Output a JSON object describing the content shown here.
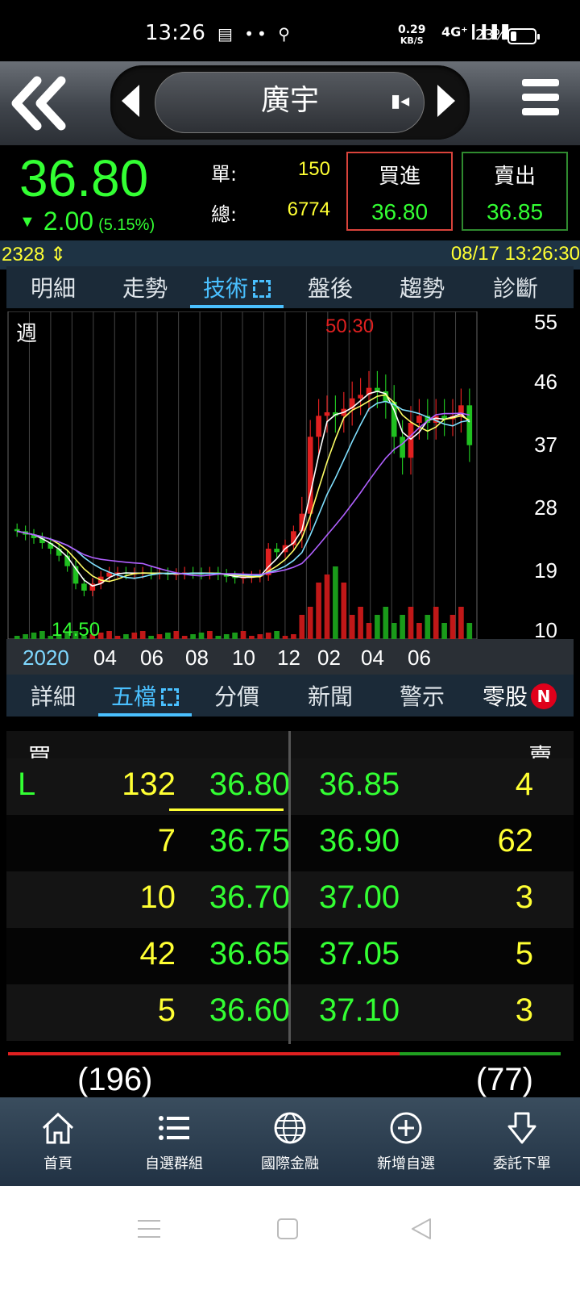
{
  "status_bar": {
    "time": "13:26",
    "net_speed_value": "0.29",
    "net_speed_unit": "KB/S",
    "signal": "4G⁺",
    "battery": "23%"
  },
  "header": {
    "stock_name": "廣宇"
  },
  "quote": {
    "price": "36.80",
    "change": "2.00",
    "change_pct": "(5.15%)",
    "single_label": "單:",
    "single_value": "150",
    "total_label": "總:",
    "total_value": "6774",
    "buy_label": "買進",
    "buy_price": "36.80",
    "sell_label": "賣出",
    "sell_price": "36.85",
    "colors": {
      "up_green": "#33ff33",
      "volume_yellow": "#ffff33",
      "buy_border": "#d9433b",
      "sell_border": "#2f8a2f"
    }
  },
  "info_bar": {
    "code": "2328",
    "datetime": "08/17 13:26:30"
  },
  "tabs_top": [
    {
      "label": "明細"
    },
    {
      "label": "走勢"
    },
    {
      "label": "技術",
      "active": true
    },
    {
      "label": "盤後"
    },
    {
      "label": "趨勢"
    },
    {
      "label": "診斷"
    }
  ],
  "chart": {
    "period_label": "週",
    "high_label": "50.30",
    "low_label": "14.50",
    "y_ticks": [
      "55",
      "46",
      "37",
      "28",
      "19",
      "10"
    ],
    "x_ticks": [
      "2020",
      "04",
      "06",
      "08",
      "10",
      "12",
      "02",
      "04",
      "06"
    ]
  },
  "chart_data": {
    "type": "candlestick",
    "ylim": [
      10,
      55
    ],
    "y_ticks": [
      55,
      46,
      37,
      28,
      19,
      10
    ],
    "x_ticks": [
      "2020",
      "04",
      "06",
      "08",
      "10",
      "12",
      "02",
      "04",
      "06"
    ],
    "period": "週",
    "highest": 50.3,
    "lowest": 14.5,
    "weekly_close_approx": [
      24.5,
      24.0,
      23.5,
      22.8,
      22.0,
      21.0,
      19.5,
      17.0,
      16.0,
      17.0,
      18.0,
      18.6,
      18.6,
      18.4,
      18.5,
      18.6,
      18.4,
      18.5,
      18.3,
      18.4,
      18.6,
      18.5,
      18.4,
      18.6,
      18.3,
      18.0,
      17.8,
      17.9,
      18.0,
      18.2,
      22.0,
      21.5,
      22.5,
      24.5,
      27.0,
      38.0,
      41.0,
      41.5,
      41.0,
      42.0,
      43.5,
      44.0,
      45.0,
      44.5,
      43.0,
      38.0,
      35.0,
      40.0,
      41.0,
      40.0,
      41.0,
      40.5,
      41.0,
      42.5,
      36.8
    ],
    "colors": {
      "up": "#e02020",
      "down": "#20c020",
      "ma_white": "#ffffff",
      "ma_yellow": "#ffff66",
      "ma_cyan": "#80e0ff",
      "ma_purple": "#b060ff"
    }
  },
  "tabs_bottom": [
    {
      "label": "詳細"
    },
    {
      "label": "五檔",
      "active": true
    },
    {
      "label": "分價"
    },
    {
      "label": "新聞"
    },
    {
      "label": "警示"
    },
    {
      "label": "零股",
      "badge": "N"
    }
  ],
  "order_book": {
    "buy_header": "買",
    "sell_header": "賣",
    "rows": [
      {
        "flag": "L",
        "bid_qty": "132",
        "bid": "36.80",
        "ask": "36.85",
        "ask_qty": "4"
      },
      {
        "flag": "",
        "bid_qty": "7",
        "bid": "36.75",
        "ask": "36.90",
        "ask_qty": "62"
      },
      {
        "flag": "",
        "bid_qty": "10",
        "bid": "36.70",
        "ask": "37.00",
        "ask_qty": "3"
      },
      {
        "flag": "",
        "bid_qty": "42",
        "bid": "36.65",
        "ask": "37.05",
        "ask_qty": "5"
      },
      {
        "flag": "",
        "bid_qty": "5",
        "bid": "36.60",
        "ask": "37.10",
        "ask_qty": "3"
      }
    ],
    "bid_total": "(196)",
    "ask_total": "(77)"
  },
  "bottom_nav": [
    {
      "label": "首頁",
      "icon": "home-icon"
    },
    {
      "label": "自選群組",
      "icon": "list-icon"
    },
    {
      "label": "國際金融",
      "icon": "globe-icon"
    },
    {
      "label": "新增自選",
      "icon": "plus-circle-icon"
    },
    {
      "label": "委託下單",
      "icon": "order-arrow-icon"
    }
  ]
}
